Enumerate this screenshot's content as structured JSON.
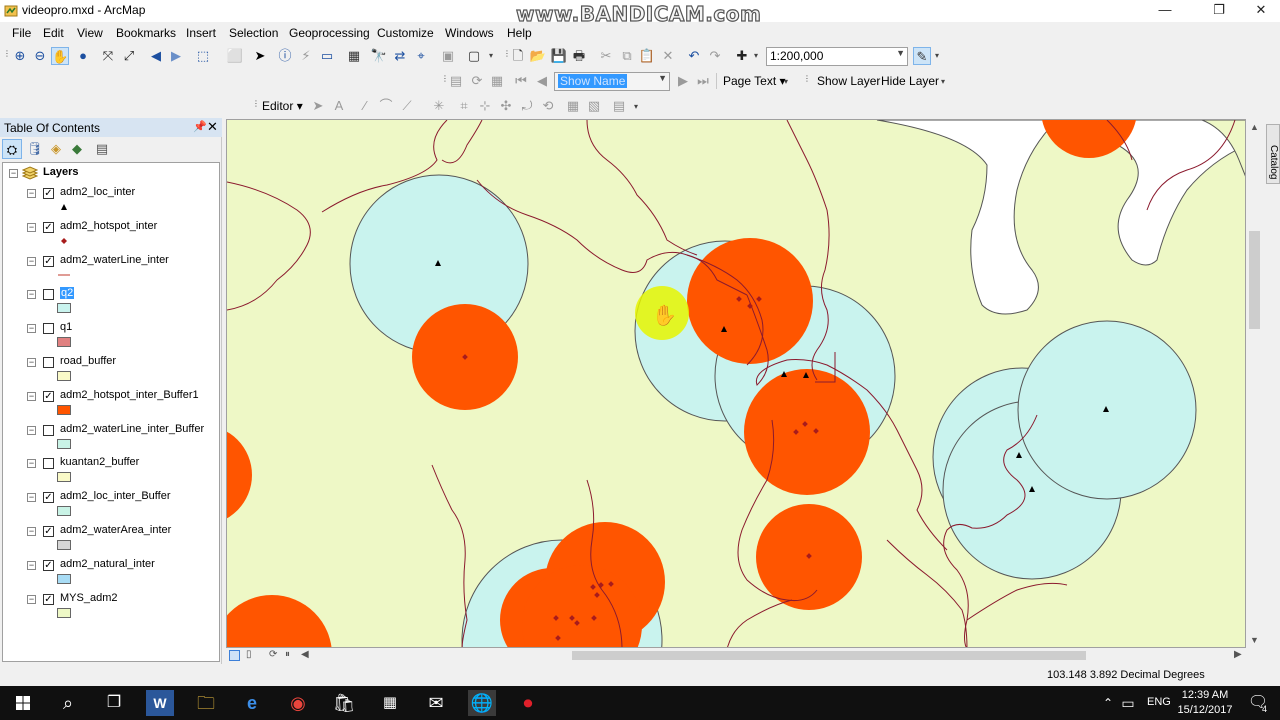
{
  "window": {
    "title": "videopro.mxd - ArcMap",
    "watermark": "www.BANDICAM.com",
    "controls": {
      "minimize": "—",
      "maximize": "❐",
      "close": "✕"
    }
  },
  "menu": [
    "File",
    "Edit",
    "View",
    "Bookmarks",
    "Insert",
    "Selection",
    "Geoprocessing",
    "Customize",
    "Windows",
    "Help"
  ],
  "toolbar": {
    "scale_value": "1:200,000",
    "layout_dropdown_placeholder": "Show Name",
    "page_text_label": "Page Text",
    "show_layer_label": "Show Layer",
    "hide_layer_label": "Hide Layer",
    "editor_label": "Editor"
  },
  "toc": {
    "title": "Table Of Contents",
    "root_label": "Layers",
    "layers": [
      {
        "name": "adm2_loc_inter",
        "checked": true,
        "symbol": "triangle",
        "color": "#000000",
        "selected": false
      },
      {
        "name": "adm2_hotspot_inter",
        "checked": true,
        "symbol": "diamond",
        "color": "#a81c1c",
        "selected": false
      },
      {
        "name": "adm2_waterLine_inter",
        "checked": true,
        "symbol": "line",
        "color": "#c0392b",
        "selected": false
      },
      {
        "name": "q2",
        "checked": false,
        "symbol": "fill",
        "color": "#c9f3ee",
        "selected": true
      },
      {
        "name": "q1",
        "checked": false,
        "symbol": "fill",
        "color": "#e08080",
        "selected": false
      },
      {
        "name": "road_buffer",
        "checked": false,
        "symbol": "fill",
        "color": "#fafac8",
        "selected": false
      },
      {
        "name": "adm2_hotspot_inter_Buffer1",
        "checked": true,
        "symbol": "fill",
        "color": "#ff5500",
        "selected": false
      },
      {
        "name": "adm2_waterLine_inter_Buffer",
        "checked": false,
        "symbol": "fill",
        "color": "#c9f3e6",
        "selected": false
      },
      {
        "name": "kuantan2_buffer",
        "checked": false,
        "symbol": "fill",
        "color": "#fafac8",
        "selected": false
      },
      {
        "name": "adm2_loc_inter_Buffer",
        "checked": true,
        "symbol": "fill",
        "color": "#c9f3e6",
        "selected": false
      },
      {
        "name": "adm2_waterArea_inter",
        "checked": true,
        "symbol": "fill",
        "color": "#d6d6d6",
        "selected": false
      },
      {
        "name": "adm2_natural_inter",
        "checked": true,
        "symbol": "fill",
        "color": "#a8dcf5",
        "selected": false
      },
      {
        "name": "MYS_adm2",
        "checked": true,
        "symbol": "fill",
        "color": "#eef8c6",
        "selected": false
      }
    ]
  },
  "catalog_tab": "Catalog",
  "status": {
    "coordinates": "103.148  3.892 Decimal Degrees"
  },
  "taskbar": {
    "language": "ENG",
    "time": "12:39 AM",
    "date": "15/12/2017",
    "notifications": "4"
  },
  "colors": {
    "land": "#eef8c6",
    "hotspot_buffer": "#ff5500",
    "loc_buffer": "#c9f3ee",
    "boundary": "#8b1a2e",
    "cursor_highlight": "#e6f500"
  }
}
